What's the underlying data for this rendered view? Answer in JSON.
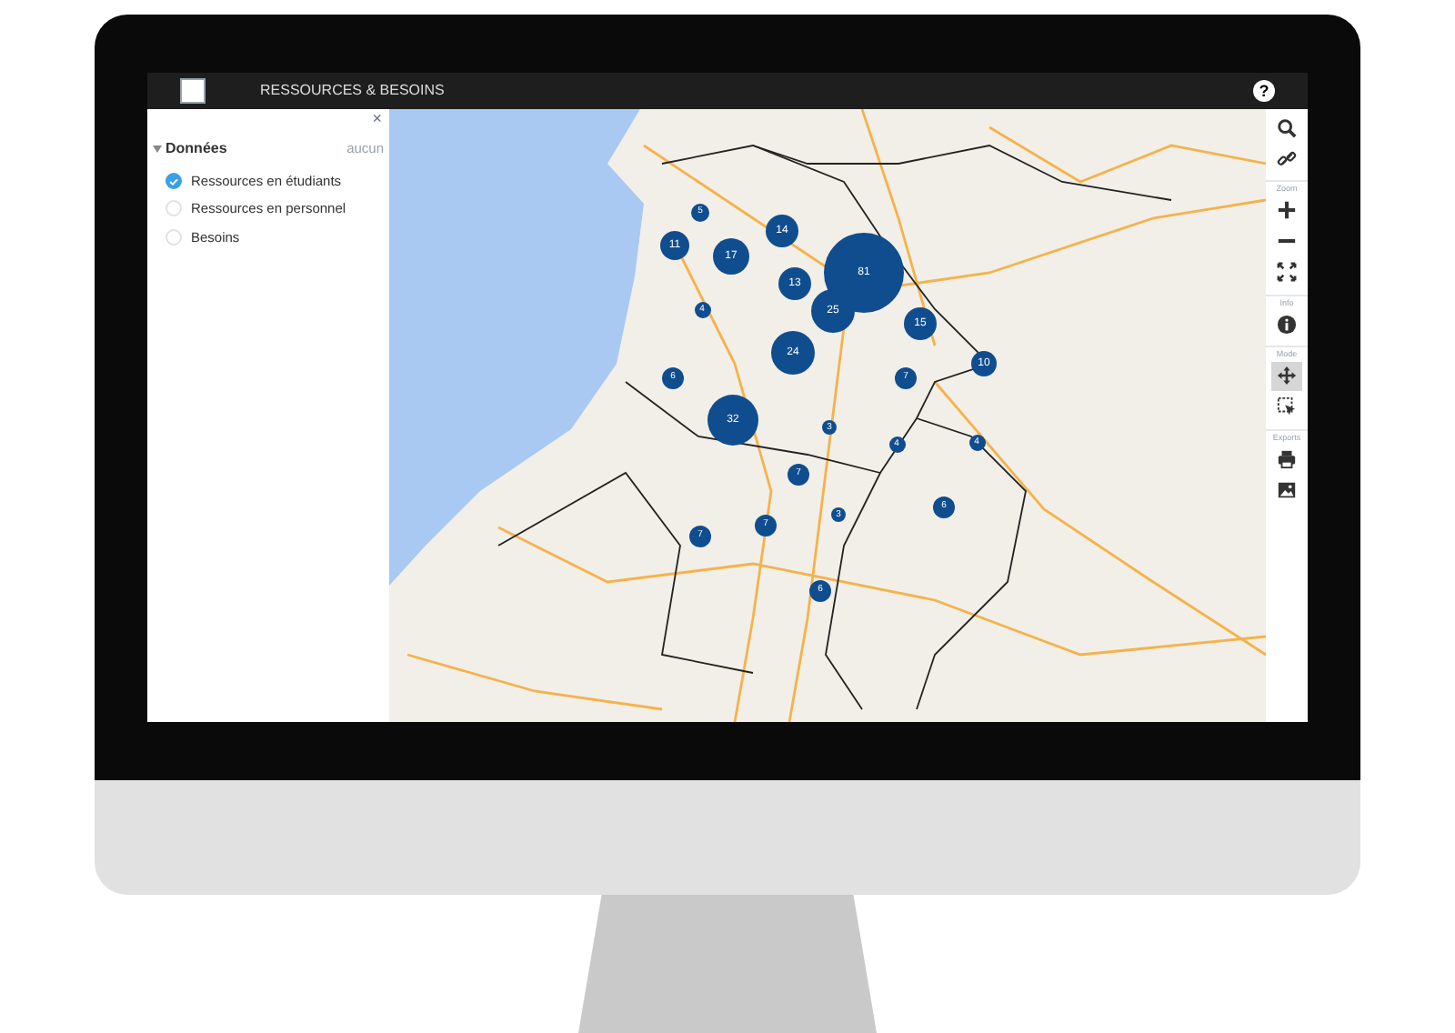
{
  "header": {
    "title": "RESSOURCES & BESOINS",
    "help": "?"
  },
  "panel": {
    "close": "×",
    "section": {
      "title": "Données",
      "expanded": true,
      "action": "aucun",
      "items": [
        {
          "label": "Ressources en étudiants",
          "selected": true
        },
        {
          "label": "Ressources en personnel",
          "selected": false
        },
        {
          "label": "Besoins",
          "selected": false
        }
      ]
    }
  },
  "map": {
    "clusters": [
      {
        "count": "5"
      },
      {
        "count": "11"
      },
      {
        "count": "17"
      },
      {
        "count": "14"
      },
      {
        "count": "81"
      },
      {
        "count": "13"
      },
      {
        "count": "25"
      },
      {
        "count": "15"
      },
      {
        "count": "4"
      },
      {
        "count": "24"
      },
      {
        "count": "10"
      },
      {
        "count": "6"
      },
      {
        "count": "7"
      },
      {
        "count": "32"
      },
      {
        "count": "3"
      },
      {
        "count": "4"
      },
      {
        "count": "4"
      },
      {
        "count": "7"
      },
      {
        "count": "3"
      },
      {
        "count": "6"
      },
      {
        "count": "7"
      },
      {
        "count": "7"
      },
      {
        "count": "6"
      }
    ]
  },
  "toolbar": {
    "items": [
      {
        "kind": "search"
      },
      {
        "kind": "link"
      },
      {
        "kind": "label",
        "text": "Zoom"
      },
      {
        "kind": "zoom-in"
      },
      {
        "kind": "zoom-out"
      },
      {
        "kind": "fullscreen"
      },
      {
        "kind": "label",
        "text": "Info"
      },
      {
        "kind": "info"
      },
      {
        "kind": "label",
        "text": "Mode"
      },
      {
        "kind": "pan",
        "selected": true
      },
      {
        "kind": "select",
        "selected": false
      },
      {
        "kind": "label",
        "text": "Exports"
      },
      {
        "kind": "print"
      },
      {
        "kind": "image"
      }
    ]
  }
}
